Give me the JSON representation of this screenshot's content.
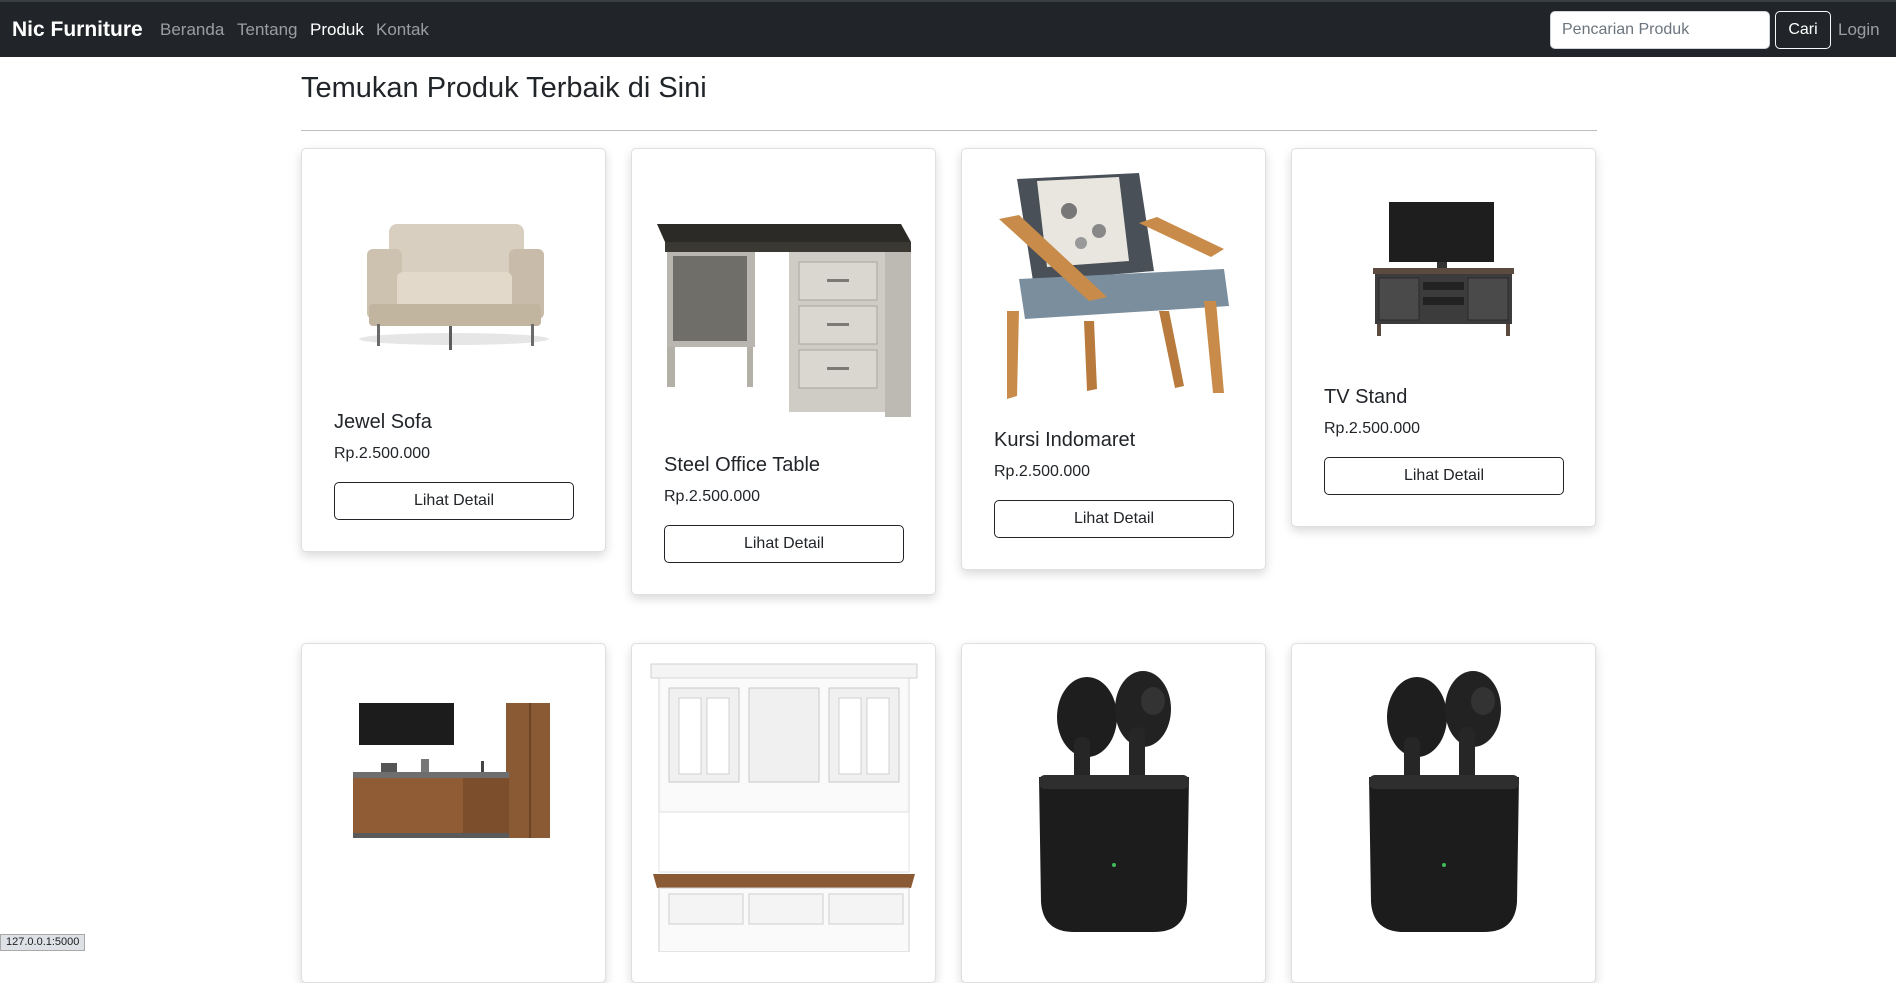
{
  "navbar": {
    "brand": "Nic Furniture",
    "links": [
      "Beranda",
      "Tentang",
      "Produk",
      "Kontak"
    ],
    "active_link": "Produk",
    "search_placeholder": "Pencarian Produk",
    "search_button": "Cari",
    "login": "Login"
  },
  "page": {
    "title": "Temukan Produk Terbaik di Sini"
  },
  "products": [
    {
      "name": "Jewel Sofa",
      "price": "Rp.2.500.000",
      "button": "Lihat Detail",
      "image_icon": "sofa-image"
    },
    {
      "name": "Steel Office Table",
      "price": "Rp.2.500.000",
      "button": "Lihat Detail",
      "image_icon": "office-table-image"
    },
    {
      "name": "Kursi Indomaret",
      "price": "Rp.2.500.000",
      "button": "Lihat Detail",
      "image_icon": "armchair-image"
    },
    {
      "name": "TV Stand",
      "price": "Rp.2.500.000",
      "button": "Lihat Detail",
      "image_icon": "tv-stand-image"
    },
    {
      "image_icon": "kitchen-set-image"
    },
    {
      "image_icon": "cabinet-image"
    },
    {
      "image_icon": "earbuds-image"
    },
    {
      "image_icon": "earbuds-image"
    }
  ],
  "status_bar": {
    "url": "127.0.0.1:5000"
  },
  "colors": {
    "navbar_bg": "#212529",
    "text": "#212529"
  }
}
